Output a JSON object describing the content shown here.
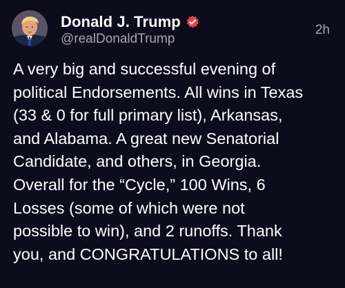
{
  "post": {
    "display_name": "Donald J. Trump",
    "handle": "@realDonaldTrump",
    "timestamp": "2h",
    "verified": true,
    "avatar_icon": "avatar-portrait",
    "verified_icon": "verified-badge-icon",
    "body_lines": [
      "A very big and successful evening of",
      "political Endorsements. All wins in Texas",
      "(33 & 0 for full primary list), Arkansas,",
      "and Alabama. A great new Senatorial",
      "Candidate, and others, in Georgia.",
      "Overall for the “Cycle,” 100 Wins, 6",
      "Losses (some of which were not",
      "possible to win), and 2 runoffs. Thank",
      "you, and CONGRATULATIONS to all!"
    ]
  },
  "colors": {
    "background": "#0d0c1d",
    "text": "#ffffff",
    "secondary_text": "#a7a4b5",
    "verified_badge": "#e8404f"
  }
}
